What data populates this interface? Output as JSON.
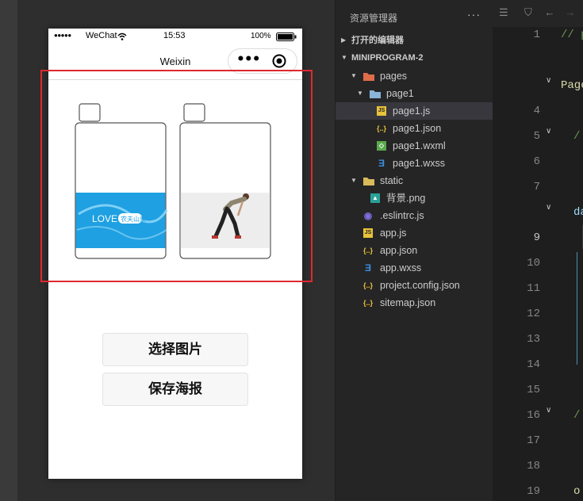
{
  "simulator": {
    "status_bar": {
      "signal_dots": "●●●●●",
      "carrier": "WeChat",
      "time": "15:53",
      "battery": "100%"
    },
    "nav_title": "Weixin",
    "capsule_menu": "•••",
    "buttons": {
      "choose_image": "选择图片",
      "save_poster": "保存海报"
    },
    "poster_left_label": "LOVE",
    "poster_left_brand": "农夫山泉",
    "highlight_color": "#e0282e"
  },
  "explorer": {
    "title": "资源管理器",
    "more": "···",
    "sections": {
      "open_editors": "打开的编辑器",
      "project": "MINIPROGRAM-2"
    },
    "tree": [
      {
        "label": "pages",
        "icon": "folder-pages-icon",
        "depth": 1,
        "arrow": "▼"
      },
      {
        "label": "page1",
        "icon": "folder-open-icon",
        "depth": 2,
        "arrow": "▼"
      },
      {
        "label": "page1.js",
        "icon": "js-file-icon",
        "depth": 3,
        "selected": true
      },
      {
        "label": "page1.json",
        "icon": "json-file-icon",
        "depth": 3
      },
      {
        "label": "page1.wxml",
        "icon": "wxml-file-icon",
        "depth": 3
      },
      {
        "label": "page1.wxss",
        "icon": "wxss-file-icon",
        "depth": 3
      },
      {
        "label": "static",
        "icon": "folder-static-icon",
        "depth": 1,
        "arrow": "▼"
      },
      {
        "label": "背景.png",
        "icon": "image-file-icon",
        "depth": 2
      },
      {
        "label": ".eslintrc.js",
        "icon": "eslint-file-icon",
        "depth": 1
      },
      {
        "label": "app.js",
        "icon": "js-file-icon",
        "depth": 1
      },
      {
        "label": "app.json",
        "icon": "json-file-icon",
        "depth": 1
      },
      {
        "label": "app.wxss",
        "icon": "wxss-file-icon",
        "depth": 1
      },
      {
        "label": "project.config.json",
        "icon": "json-file-icon",
        "depth": 1
      },
      {
        "label": "sitemap.json",
        "icon": "json-file-icon",
        "depth": 1
      }
    ]
  },
  "editor": {
    "line_numbers": [
      "1",
      "",
      "",
      "4",
      "5",
      "6",
      "7",
      "",
      "9",
      "10",
      "11",
      "12",
      "13",
      "14",
      "15",
      "16",
      "17",
      "18",
      "19"
    ],
    "current_line": "9",
    "code_fragments": {
      "line1": "// p",
      "line3": "Page",
      "line5": "/",
      "line8": "da",
      "line16": "/",
      "line19": "o"
    }
  }
}
